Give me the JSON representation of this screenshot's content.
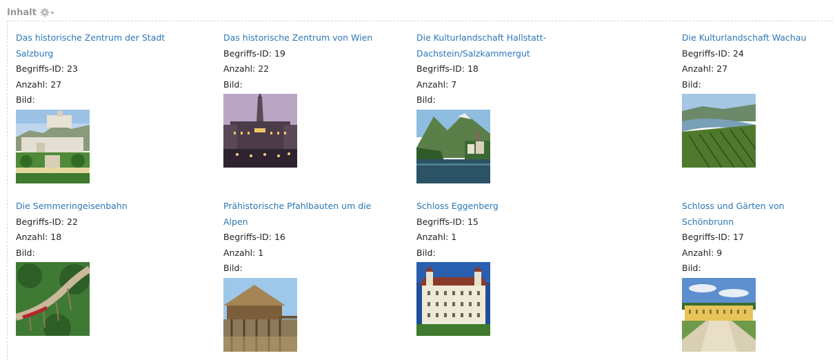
{
  "panel": {
    "title": "Inhalt",
    "settings_icon": "gear-dropdown-icon"
  },
  "labels": {
    "id_prefix": "Begriffs-ID: ",
    "count_prefix": "Anzahl: ",
    "image_label": "Bild:"
  },
  "items": [
    {
      "title": "Das historische Zentrum der Stadt Salzburg",
      "title_line1": "Das historische Zentrum der Stadt",
      "title_line2": "Salzburg",
      "id": "23",
      "count": "27",
      "id_text": "Begriffs-ID: 23",
      "count_text": "Anzahl: 27",
      "image": "salzburg-photo"
    },
    {
      "title": "Das historische Zentrum von Wien",
      "title_line1": "Das historische Zentrum von Wien",
      "title_line2": "",
      "id": "19",
      "count": "22",
      "id_text": "Begriffs-ID: 19",
      "count_text": "Anzahl: 22",
      "image": "vienna-cityhall-photo"
    },
    {
      "title": "Die Kulturlandschaft Hallstatt-Dachstein/Salzkammergut",
      "title_line1": "Die Kulturlandschaft Hallstatt-",
      "title_line2": "Dachstein/Salzkammergut",
      "id": "18",
      "count": "7",
      "id_text": "Begriffs-ID: 18",
      "count_text": "Anzahl: 7",
      "image": "hallstatt-photo"
    },
    {
      "title": "Die Kulturlandschaft Wachau",
      "title_line1": "Die Kulturlandschaft Wachau",
      "title_line2": "",
      "id": "24",
      "count": "27",
      "id_text": "Begriffs-ID: 24",
      "count_text": "Anzahl: 27",
      "image": "wachau-photo"
    },
    {
      "title": "Die Semmeringeisenbahn",
      "title_line1": "Die Semmeringeisenbahn",
      "title_line2": "",
      "id": "22",
      "count": "18",
      "id_text": "Begriffs-ID: 22",
      "count_text": "Anzahl: 18",
      "image": "semmering-railway-photo"
    },
    {
      "title": "Prähistorische Pfahlbauten um die Alpen",
      "title_line1": "Prähistorische Pfahlbauten um die",
      "title_line2": "Alpen",
      "id": "16",
      "count": "1",
      "id_text": "Begriffs-ID: 16",
      "count_text": "Anzahl: 1",
      "image": "pile-dwellings-photo"
    },
    {
      "title": "Schloss Eggenberg",
      "title_line1": "Schloss Eggenberg",
      "title_line2": "",
      "id": "15",
      "count": "1",
      "id_text": "Begriffs-ID: 15",
      "count_text": "Anzahl: 1",
      "image": "eggenberg-palace-photo"
    },
    {
      "title": "Schloss und Gärten von Schönbrunn",
      "title_line1": "Schloss und Gärten von",
      "title_line2": "Schönbrunn",
      "id": "17",
      "count": "9",
      "id_text": "Begriffs-ID: 17",
      "count_text": "Anzahl: 9",
      "image": "schoenbrunn-photo"
    }
  ]
}
